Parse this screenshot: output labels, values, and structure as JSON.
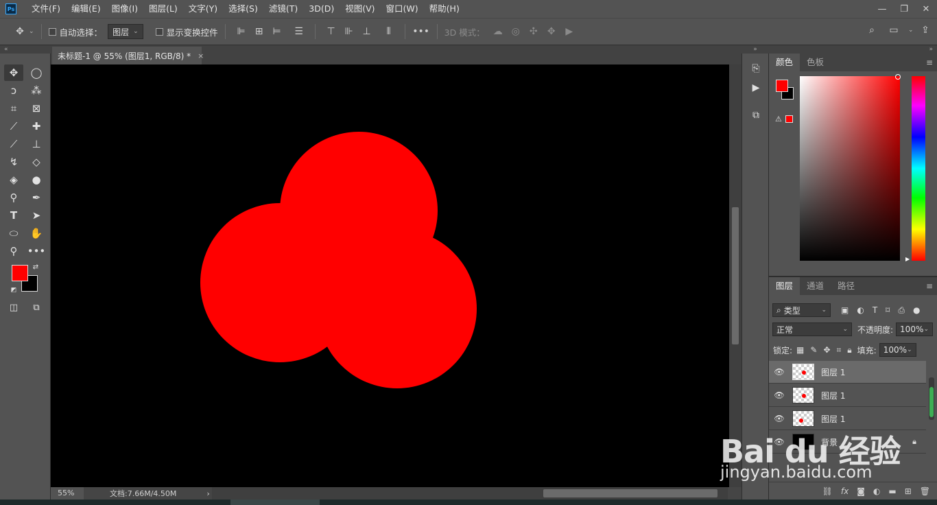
{
  "app": {
    "logo_text": "Ps",
    "menu": [
      "文件(F)",
      "编辑(E)",
      "图像(I)",
      "图层(L)",
      "文字(Y)",
      "选择(S)",
      "滤镜(T)",
      "3D(D)",
      "视图(V)",
      "窗口(W)",
      "帮助(H)"
    ],
    "window_controls": {
      "minimize": "—",
      "restore": "❐",
      "close": "✕"
    }
  },
  "options_bar": {
    "auto_select_label": "自动选择：",
    "auto_select_target": "图层",
    "show_transform_label": "显示变换控件",
    "more": "•••",
    "mode_3d_label": "3D 模式："
  },
  "document": {
    "tab_title": "未标题-1 @ 55% (图层1, RGB/8) *",
    "tab_close": "×",
    "zoom": "55%",
    "doc_info": "文档:7.66M/4.50M",
    "status_arrow": "›",
    "canvas_background": "#000000",
    "shape_color": "#ff0000"
  },
  "tools": {
    "foreground_color": "#ff0000",
    "background_color": "#000000"
  },
  "color_panel": {
    "tabs": [
      "颜色",
      "色板"
    ],
    "active_tab": 0,
    "menu_icon": "≡",
    "warning": "⚠"
  },
  "layers_panel": {
    "tabs": [
      "图层",
      "通道",
      "路径"
    ],
    "active_tab": 0,
    "menu_icon": "≡",
    "filter_label": "类型",
    "blend_mode": "正常",
    "opacity_label": "不透明度:",
    "opacity_value": "100%",
    "lock_label": "锁定:",
    "fill_label": "填充:",
    "fill_value": "100%",
    "layers": [
      {
        "name": "图层 1",
        "selected": true
      },
      {
        "name": "图层 1",
        "selected": false
      },
      {
        "name": "图层 1",
        "selected": false
      },
      {
        "name": "背景",
        "selected": false,
        "locked": true
      }
    ],
    "bottom_icons": [
      "link-icon",
      "fx-icon",
      "mask-icon",
      "adjustment-icon",
      "folder-icon",
      "new-layer-icon",
      "trash-icon"
    ],
    "fx_label": "fx"
  },
  "watermark": {
    "logo": "Bai du 经验",
    "url": "jingyan.baidu.com"
  }
}
